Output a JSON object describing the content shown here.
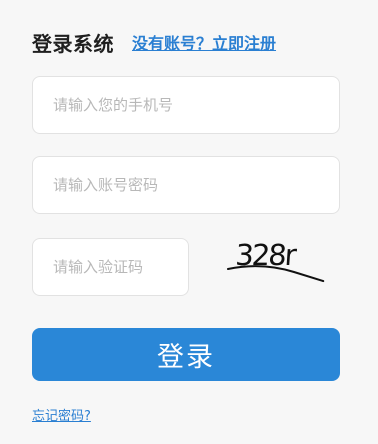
{
  "header": {
    "title": "登录系统",
    "register_link": "没有账号？立即注册"
  },
  "form": {
    "phone": {
      "value": "",
      "placeholder": "请输入您的手机号"
    },
    "password": {
      "value": "",
      "placeholder": "请输入账号密码"
    },
    "captcha": {
      "value": "",
      "placeholder": "请输入验证码"
    },
    "captcha_image_text": "328r",
    "login_label": "登录"
  },
  "footer": {
    "forgot_link": "忘记密码?"
  },
  "colors": {
    "accent": "#2a87d7",
    "link": "#2a7fd2",
    "background": "#f7f7f7",
    "input_border": "#e2e2e2"
  }
}
